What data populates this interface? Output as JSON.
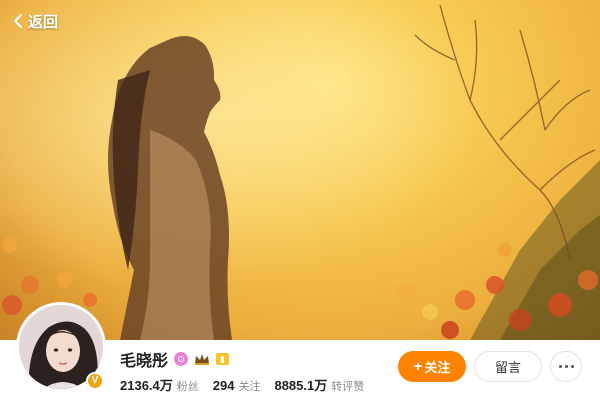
{
  "header": {
    "back_label": "返回",
    "back_icon": "chevron-left-icon"
  },
  "profile": {
    "name": "毛晓彤",
    "badges": [
      "svip-badge-icon",
      "crown-badge-icon",
      "level-badge-icon"
    ],
    "verified_icon": "verified-v-icon",
    "stats": [
      {
        "value": "2136.4万",
        "label": "粉丝"
      },
      {
        "value": "294",
        "label": "关注"
      },
      {
        "value": "8885.1万",
        "label": "转评赞"
      }
    ]
  },
  "actions": {
    "follow_label": "关注",
    "message_label": "留言",
    "more_icon": "more-dots-icon"
  },
  "colors": {
    "accent": "#ff8200",
    "cover_warm": "#f7c84f",
    "verified": "#f2a30f"
  }
}
